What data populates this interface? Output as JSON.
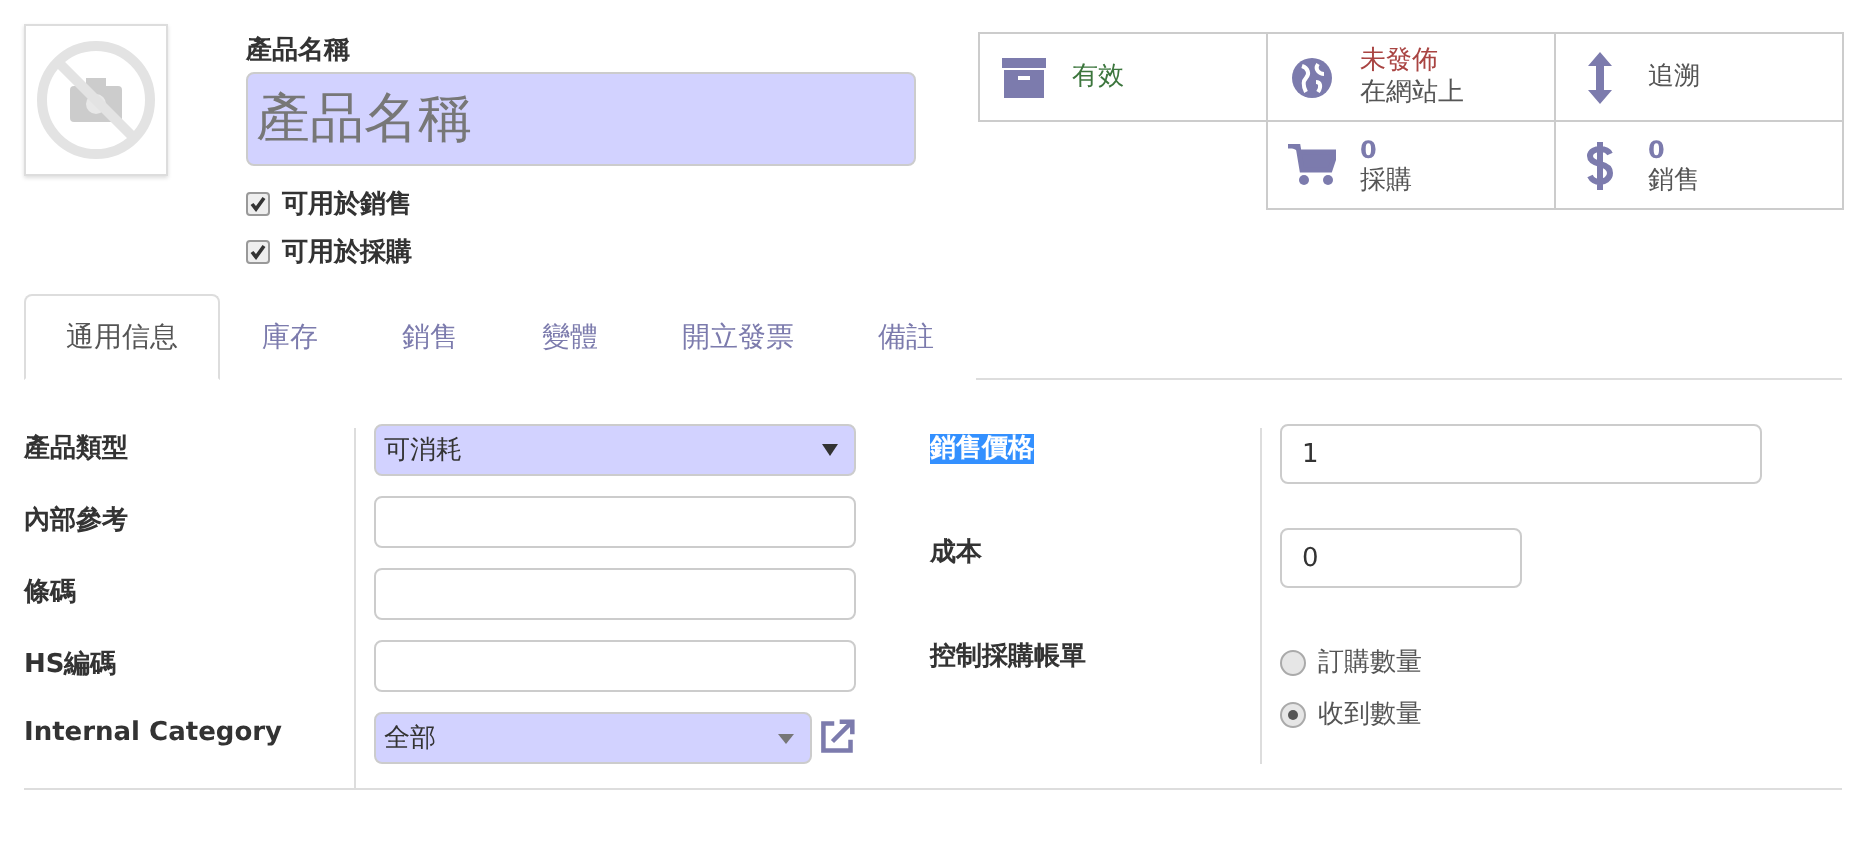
{
  "header": {
    "name_label": "產品名稱",
    "name_field": {
      "placeholder": "產品名稱"
    },
    "options": [
      {
        "label": "可用於銷售",
        "checked": true
      },
      {
        "label": "可用於採購",
        "checked": true
      }
    ]
  },
  "stat_buttons": [
    {
      "kind": "status",
      "text": "有效",
      "color": "#3c763d"
    },
    {
      "kind": "status",
      "text": "未發佈",
      "subtext": "在網站上",
      "color": "#a94442"
    },
    {
      "kind": "label",
      "text": "追溯"
    },
    {
      "kind": "count",
      "value": "0",
      "text": "採購"
    },
    {
      "kind": "count",
      "value": "0",
      "text": "銷售"
    }
  ],
  "tabs": [
    {
      "label": "通用信息",
      "selected": true
    },
    {
      "label": "庫存",
      "selected": false
    },
    {
      "label": "銷售",
      "selected": false
    },
    {
      "label": "變體",
      "selected": false
    },
    {
      "label": "開立發票",
      "selected": false
    },
    {
      "label": "備註",
      "selected": false
    }
  ],
  "left_fields": [
    {
      "kind": "select",
      "label": "產品類型",
      "value": "可消耗",
      "required": true
    },
    {
      "kind": "input",
      "label": "內部參考"
    },
    {
      "kind": "input",
      "label": "條碼"
    },
    {
      "kind": "input",
      "label": "HS編碼"
    },
    {
      "kind": "many2one",
      "label": "Internal Category",
      "value": "全部",
      "required": true
    }
  ],
  "right_fields": [
    {
      "kind": "input",
      "label": "銷售價格",
      "value": "1",
      "highlighted": true
    },
    {
      "kind": "input",
      "label": "成本",
      "value": "0",
      "highlighted": false
    },
    {
      "kind": "radio",
      "label": "控制採購帳單",
      "highlighted": false,
      "options": [
        {
          "label": "訂購數量",
          "selected": false
        },
        {
          "label": "收到數量",
          "selected": true
        }
      ]
    }
  ]
}
